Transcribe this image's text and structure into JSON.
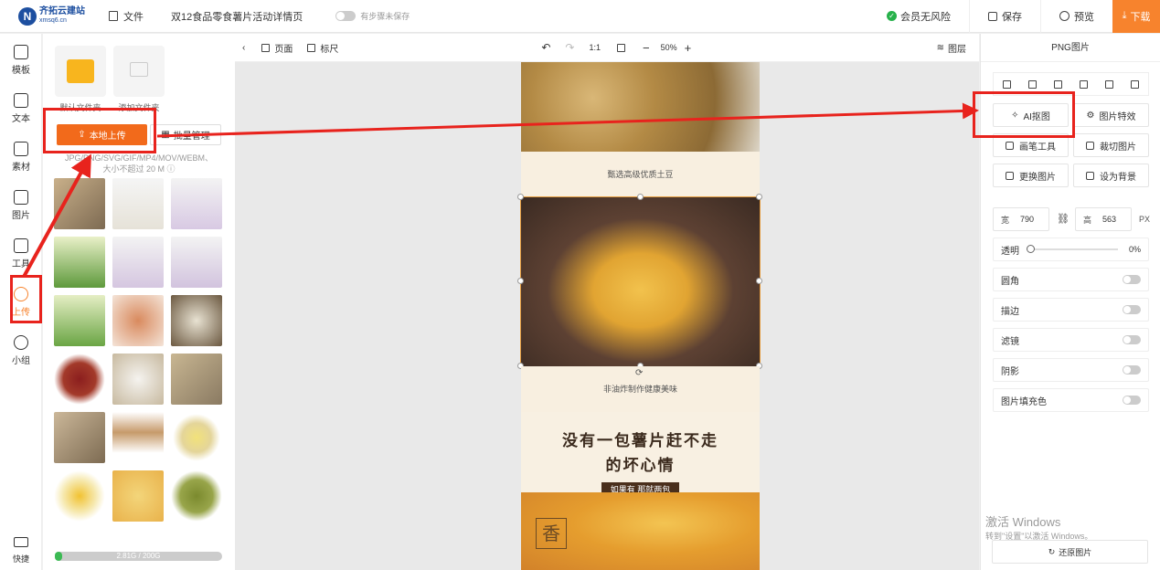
{
  "topbar": {
    "logo_mark": "N",
    "logo_name": "齐拓云建站",
    "logo_domain": "xmsq6.cn",
    "file_label": "文件",
    "doc_title": "双12食品零食薯片活动详情页",
    "autosave_label": "有步骤未保存",
    "vip_label": "会员无风险",
    "save_label": "保存",
    "preview_label": "预览",
    "download_label": "下载"
  },
  "rail": {
    "items": [
      {
        "label": "模板"
      },
      {
        "label": "文本"
      },
      {
        "label": "素材"
      },
      {
        "label": "图片"
      },
      {
        "label": "工具"
      },
      {
        "label": "上传"
      },
      {
        "label": "小组"
      }
    ],
    "bottom_label": "快捷"
  },
  "upload_panel": {
    "folder1_label": "默认文件夹",
    "folder2_label": "添加文件夹",
    "upload_button": "本地上传",
    "batch_button": "批量管理",
    "formats_hint": "JPG/PNG/SVG/GIF/MP4/MOV/WEBM、",
    "size_hint": "大小不超过 20 M",
    "storage_text": "2.81G / 200G",
    "storage_fraction": 0.014
  },
  "canvas_bar": {
    "page_label": "页面",
    "ruler_label": "标尺",
    "ratio_label": "1:1",
    "zoom": "50%",
    "layers_label": "图层"
  },
  "canvas": {
    "caption1": "甄选高级优质土豆",
    "caption2": "非油炸制作健康美味",
    "slogan_line1": "没有一包薯片赶不走",
    "slogan_line2": "的坏心情",
    "slogan_tag": "如果有 那就两包",
    "badge_char": "香"
  },
  "right_panel": {
    "title": "PNG图片",
    "buttons": {
      "ai_cutout": "AI抠图",
      "image_effects": "图片特效",
      "brush_tool": "画笔工具",
      "crop_image": "裁切图片",
      "replace_image": "更换图片",
      "set_background": "设为背景"
    },
    "width_key": "宽",
    "width_value": "790",
    "height_key": "高",
    "height_value": "563",
    "unit": "PX",
    "opacity_label": "透明",
    "opacity_value": "0%",
    "toggles": [
      "圆角",
      "描边",
      "滤镜",
      "阴影",
      "图片填充色"
    ],
    "restore_button": "还原图片"
  },
  "watermark": {
    "line1": "激活 Windows",
    "line2": "转到\"设置\"以激活 Windows。"
  },
  "colors": {
    "accent": "#f7832d",
    "annotation_red": "#e8231d",
    "brand_blue": "#1d4fa0"
  }
}
